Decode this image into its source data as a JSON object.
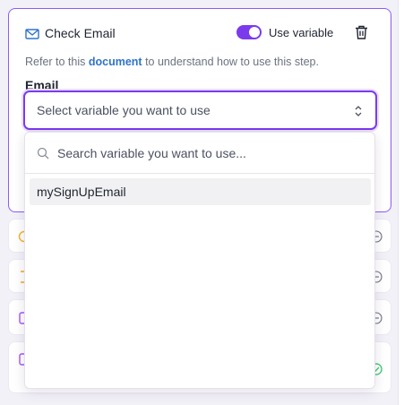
{
  "step": {
    "title": "Check Email",
    "use_variable_label": "Use variable",
    "use_variable_on": true,
    "help_prefix": "Refer to this ",
    "help_link": "document",
    "help_suffix": " to understand how to use this step.",
    "field_label": "Email",
    "select_placeholder": "Select variable you want to use"
  },
  "dropdown": {
    "search_placeholder": "Search variable you want to use...",
    "options": [
      {
        "label": "mySignUpEmail"
      }
    ]
  },
  "icons": {
    "title": "mail-icon",
    "delete": "trash-icon",
    "select": "chevron-up-down-icon",
    "search": "search-icon"
  },
  "colors": {
    "accent": "#7c3aed",
    "link": "#2f73c9",
    "row_icons": [
      "#f0b429",
      "#f5a524",
      "#a855f7",
      "#a855f7"
    ],
    "row_status": [
      "#6b7280",
      "#6b7280",
      "#6b7280",
      "#22c55e"
    ]
  }
}
